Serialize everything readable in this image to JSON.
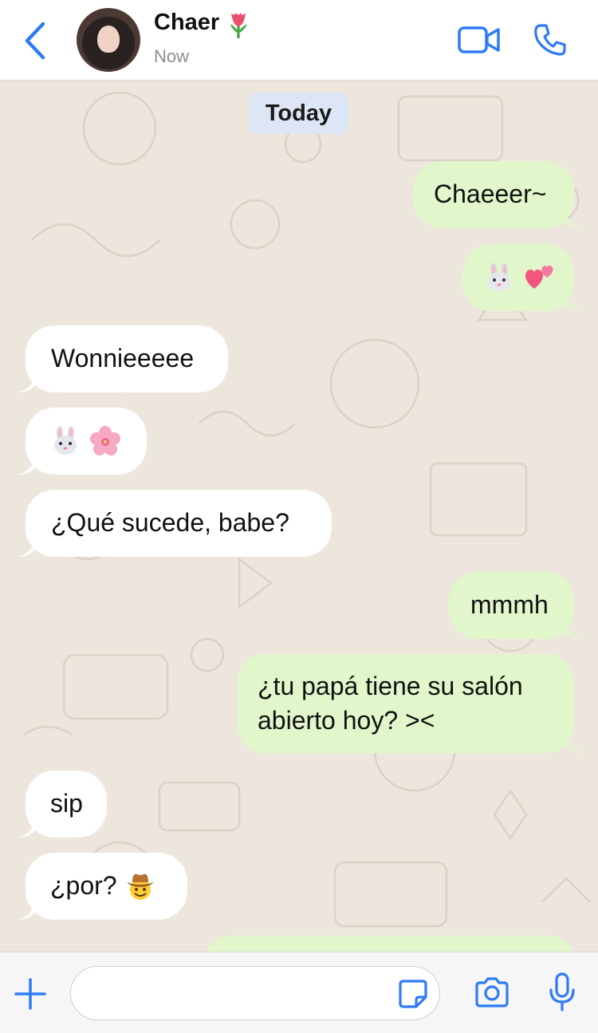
{
  "header": {
    "contact_name": "Chaer",
    "name_emoji": "tulip",
    "status": "Now",
    "icons": [
      "back-chevron-icon",
      "video-camera-icon",
      "phone-icon"
    ]
  },
  "chat": {
    "date_label": "Today",
    "messages": [
      {
        "dir": "out",
        "text": "Chaeeer~"
      },
      {
        "dir": "out",
        "emojis": [
          "rabbit-face",
          "two-hearts"
        ]
      },
      {
        "dir": "in",
        "text": "Wonnieeeee"
      },
      {
        "dir": "in",
        "emojis": [
          "rabbit-face",
          "cherry-blossom"
        ]
      },
      {
        "dir": "in",
        "text": "¿Qué sucede, babe?"
      },
      {
        "dir": "out",
        "text": "mmmh"
      },
      {
        "dir": "out",
        "text_lines": [
          "¿tu papá tiene su salón",
          "abierto hoy? ><"
        ]
      },
      {
        "dir": "in",
        "text": "sip"
      },
      {
        "dir": "in",
        "text": "¿por?",
        "emojis": [
          "cowboy-face"
        ]
      }
    ]
  },
  "input_bar": {
    "placeholder": "",
    "icons": [
      "plus-icon",
      "sticker-icon",
      "camera-icon",
      "microphone-icon"
    ]
  },
  "colors": {
    "accent": "#2f7bf6",
    "outgoing_bubble": "#e1f7cb",
    "incoming_bubble": "#ffffff",
    "wallpaper": "#ece6dd",
    "date_chip": "#dde6f5"
  }
}
